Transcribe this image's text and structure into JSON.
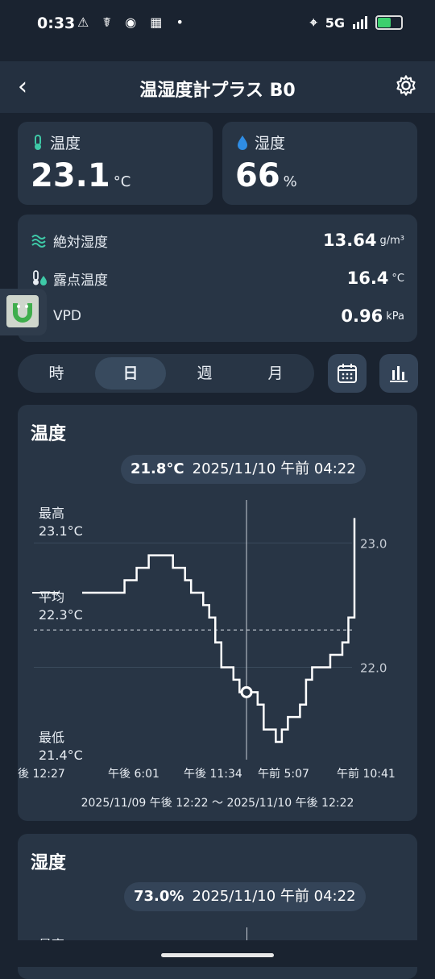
{
  "status": {
    "time": "0:33",
    "network": "5G"
  },
  "header": {
    "title": "温湿度計プラス B0"
  },
  "temperature": {
    "label": "温度",
    "value": "23.1",
    "unit": "°C"
  },
  "humidity": {
    "label": "湿度",
    "value": "66",
    "unit": "%"
  },
  "metrics": [
    {
      "label": "絶対湿度",
      "value": "13.64",
      "unit": "g/m³"
    },
    {
      "label": "露点温度",
      "value": "16.4",
      "unit": "°C"
    },
    {
      "label": "VPD",
      "value": "0.96",
      "unit": "kPa"
    }
  ],
  "tabs": [
    "時",
    "日",
    "週",
    "月"
  ],
  "active_tab": "日",
  "chart1": {
    "title": "温度",
    "tooltip_value": "21.8°C",
    "tooltip_time": "2025/11/10 午前 04:22",
    "max_label": "最高",
    "max_value": "23.1°C",
    "avg_label": "平均",
    "avg_value": "22.3°C",
    "min_label": "最低",
    "min_value": "21.4°C",
    "x_ticks": [
      "後 12:27",
      "午後 6:01",
      "午後 11:34",
      "午前 5:07",
      "午前 10:41"
    ],
    "y_ticks": [
      "23.0",
      "22.0"
    ],
    "range": "2025/11/09 午後 12:22 〜 2025/11/10 午後 12:22"
  },
  "chart_data": {
    "type": "line",
    "title": "温度",
    "ylim": [
      21.4,
      23.3
    ],
    "y_ticks": [
      23.0,
      22.0
    ],
    "x_ticks": [
      "後 12:27",
      "午後 6:01",
      "午後 11:34",
      "午前 5:07",
      "午前 10:41"
    ],
    "average": 22.3,
    "selected": {
      "time": "2025/11/10 午前 04:22",
      "value": 21.8
    },
    "series": [
      {
        "values": [
          22.6,
          22.6,
          22.6,
          22.6,
          22.6,
          22.6,
          22.6,
          22.7,
          22.7,
          22.8,
          22.8,
          22.9,
          22.9,
          22.9,
          22.9,
          22.8,
          22.8,
          22.7,
          22.6,
          22.6,
          22.5,
          22.4,
          22.2,
          22.0,
          22.0,
          21.9,
          21.8,
          21.8,
          21.8,
          21.7,
          21.5,
          21.5,
          21.4,
          21.5,
          21.6,
          21.6,
          21.7,
          21.9,
          22.0,
          22.0,
          22.0,
          22.1,
          22.1,
          22.2,
          22.4,
          23.2
        ]
      }
    ]
  },
  "chart2": {
    "title": "湿度",
    "tooltip_value": "73.0%",
    "tooltip_time": "2025/11/10 午前 04:22",
    "max_label": "最高"
  }
}
